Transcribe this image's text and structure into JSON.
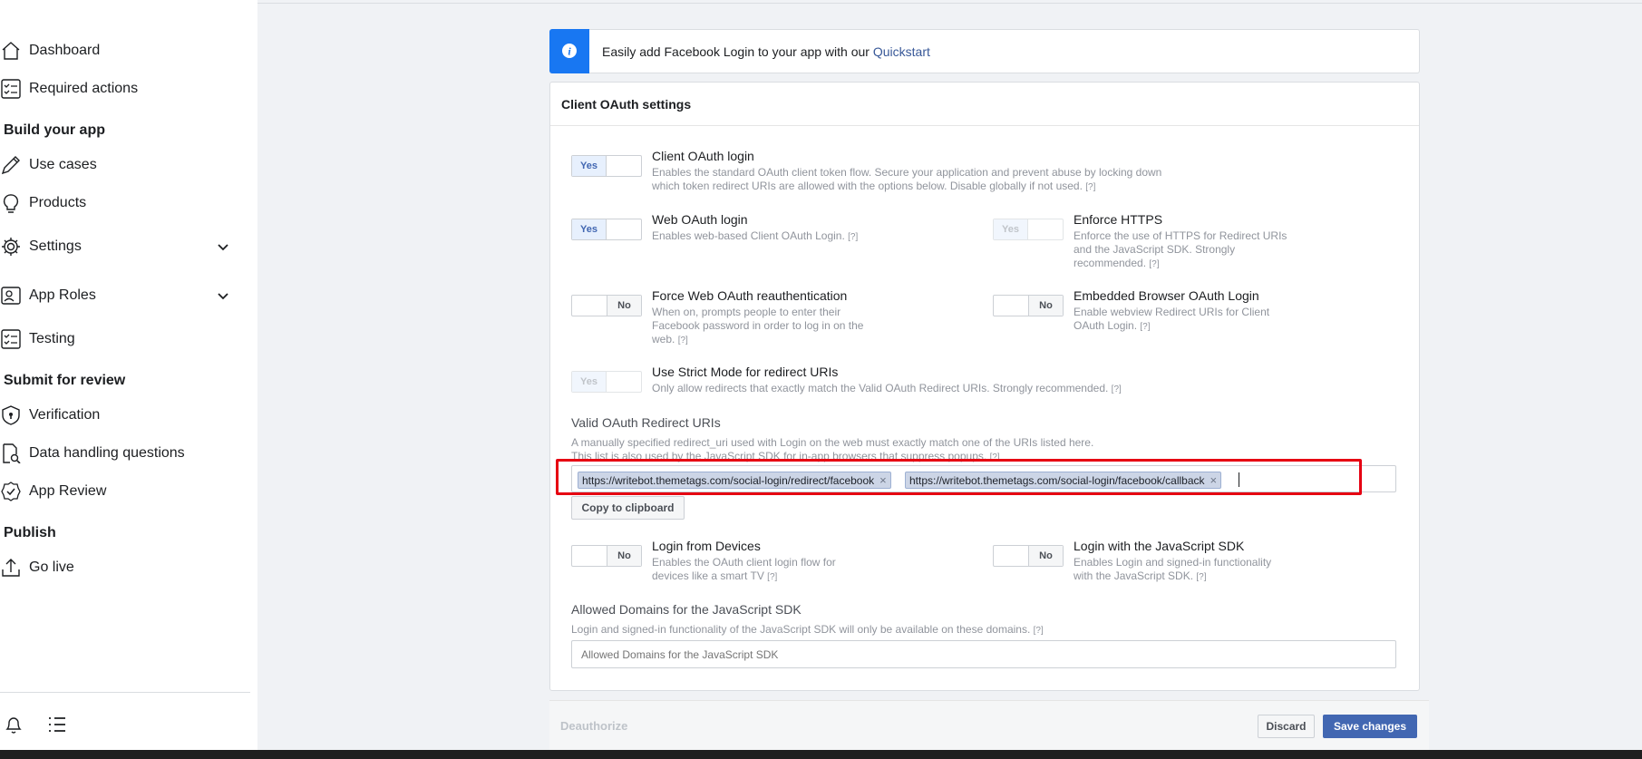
{
  "sidebar": {
    "items": [
      {
        "label": "Dashboard",
        "icon": "home-icon"
      },
      {
        "label": "Required actions",
        "icon": "checklist-icon"
      },
      {
        "label": "Use cases",
        "icon": "pencil-icon"
      },
      {
        "label": "Products",
        "icon": "lightbulb-icon"
      },
      {
        "label": "Settings",
        "icon": "gear-icon"
      },
      {
        "label": "App Roles",
        "icon": "badge-icon"
      },
      {
        "label": "Testing",
        "icon": "checklist-icon"
      },
      {
        "label": "Verification",
        "icon": "shield-icon"
      },
      {
        "label": "Data handling questions",
        "icon": "document-search-icon"
      },
      {
        "label": "App Review",
        "icon": "verified-icon"
      },
      {
        "label": "Go live",
        "icon": "upload-icon"
      }
    ],
    "sections": {
      "build": "Build your app",
      "submit": "Submit for review",
      "publish": "Publish"
    }
  },
  "banner": {
    "text": "Easily add Facebook Login to your app with our ",
    "link": "Quickstart"
  },
  "card": {
    "title": "Client OAuth settings",
    "options": {
      "client_oauth": {
        "title": "Client OAuth login",
        "desc1": "Enables the standard OAuth client token flow. Secure your application and prevent abuse by locking down",
        "desc2": "which token redirect URIs are allowed with the options below. Disable globally if not used.",
        "state": "Yes"
      },
      "web_oauth": {
        "title": "Web OAuth login",
        "desc1": "Enables web-based Client OAuth Login.",
        "state": "Yes"
      },
      "enforce_https": {
        "title": "Enforce HTTPS",
        "desc1": "Enforce the use of HTTPS for Redirect URIs",
        "desc2": "and the JavaScript SDK. Strongly",
        "desc3": "recommended.",
        "state": "Yes"
      },
      "force_reauth": {
        "title": "Force Web OAuth reauthentication",
        "desc1": "When on, prompts people to enter their",
        "desc2": "Facebook password in order to log in on the",
        "desc3": "web.",
        "state": "No"
      },
      "embedded_browser": {
        "title": "Embedded Browser OAuth Login",
        "desc1": "Enable webview Redirect URIs for Client",
        "desc2": "OAuth Login.",
        "state": "No"
      },
      "strict_mode": {
        "title": "Use Strict Mode for redirect URIs",
        "desc1": "Only allow redirects that exactly match the Valid OAuth Redirect URIs. Strongly recommended.",
        "state": "Yes"
      },
      "login_devices": {
        "title": "Login from Devices",
        "desc1": "Enables the OAuth client login flow for",
        "desc2": "devices like a smart TV",
        "state": "No"
      },
      "login_js_sdk": {
        "title": "Login with the JavaScript SDK",
        "desc1": "Enables Login and signed-in functionality",
        "desc2": "with the JavaScript SDK.",
        "state": "No"
      }
    },
    "help": "[?]",
    "redirect_uris": {
      "label": "Valid OAuth Redirect URIs",
      "desc1": "A manually specified redirect_uri used with Login on the web must exactly match one of the URIs listed here.",
      "desc2": "This list is also used by the JavaScript SDK for in-app browsers that suppress popups.",
      "tokens": [
        "https://writebot.themetags.com/social-login/redirect/facebook",
        "https://writebot.themetags.com/social-login/facebook/callback"
      ],
      "copy_label": "Copy to clipboard"
    },
    "allowed_domains": {
      "label": "Allowed Domains for the JavaScript SDK",
      "desc": "Login and signed-in functionality of the JavaScript SDK will only be available on these domains.",
      "placeholder": "Allowed Domains for the JavaScript SDK"
    }
  },
  "footer": {
    "deauthorize": "Deauthorize",
    "discard": "Discard",
    "save": "Save changes"
  },
  "colors": {
    "accent": "#4267b2",
    "info": "#1877f2",
    "highlight": "#e60012"
  }
}
